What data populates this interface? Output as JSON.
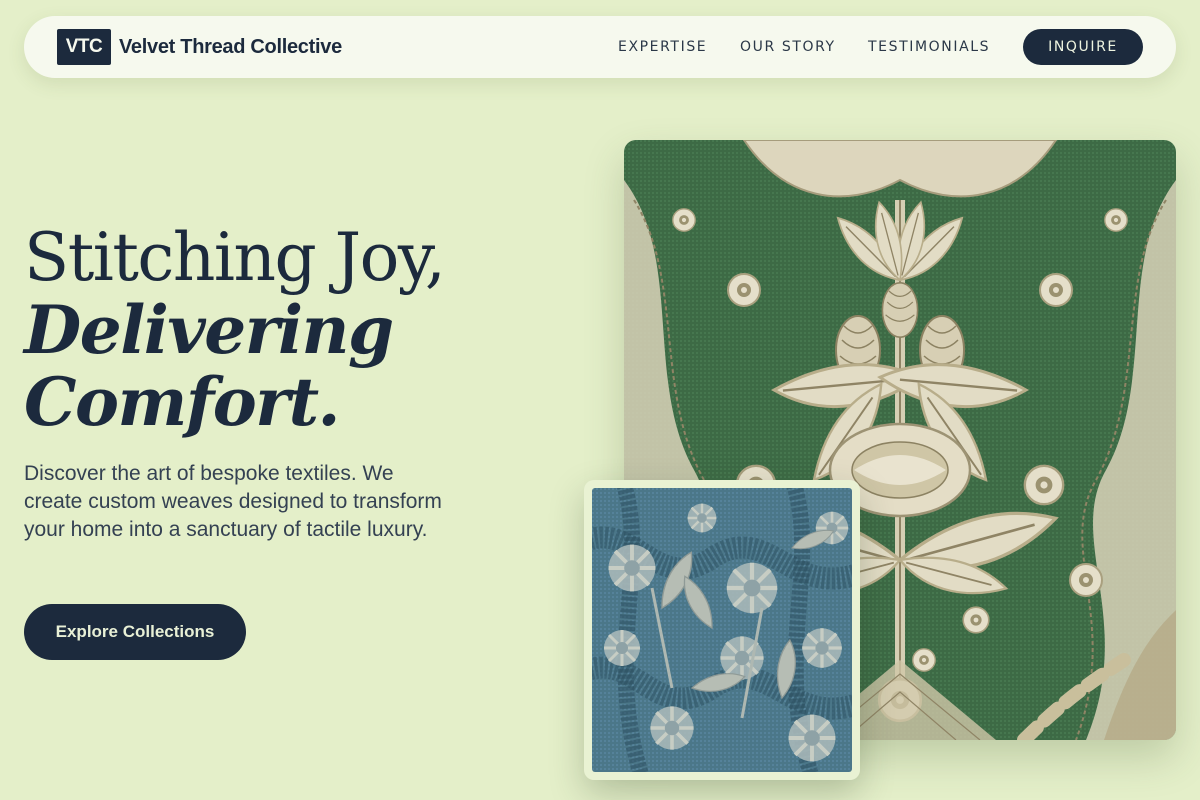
{
  "nav": {
    "logo_mark": "VTC",
    "brand": "Velvet Thread Collective",
    "links": [
      "EXPERTISE",
      "OUR STORY",
      "TESTIMONIALS"
    ],
    "cta": "INQUIRE"
  },
  "hero": {
    "title_line1": "Stitching Joy,",
    "title_line2": "Delivering",
    "title_line3": "Comfort.",
    "description": "Discover the art of bespoke textiles. We create custom weaves designed to transform your home into a sanctuary of tactile luxury.",
    "cta": "Explore Collections"
  },
  "colors": {
    "background": "#e4efc9",
    "navy": "#1c2a3d",
    "green_damask": "#3f6b47",
    "blue_brocade": "#4e7a8c"
  }
}
